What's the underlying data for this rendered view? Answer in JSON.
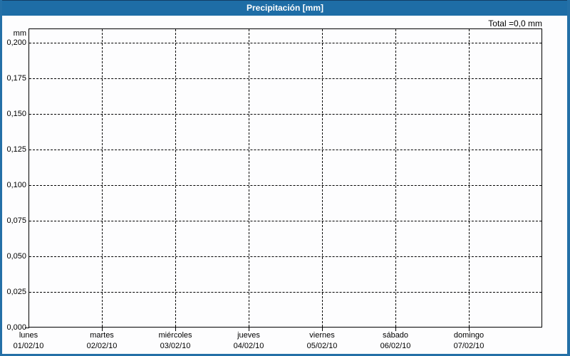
{
  "header": {
    "title": "Precipitación [mm]"
  },
  "summary": {
    "total_label": "Total =0,0 mm"
  },
  "y_axis": {
    "unit_label": "mm"
  },
  "chart_data": {
    "type": "bar",
    "title": "Precipitación [mm]",
    "xlabel": "",
    "ylabel": "mm",
    "ylim": [
      0,
      0.21
    ],
    "grid": "dashed-horizontal-and-vertical",
    "legend": "none",
    "total_annotation": "Total =0,0 mm",
    "y_ticks": [
      {
        "label": "0,200",
        "value": 0.2
      },
      {
        "label": "0,175",
        "value": 0.175
      },
      {
        "label": "0,150",
        "value": 0.15
      },
      {
        "label": "0,125",
        "value": 0.125
      },
      {
        "label": "0,100",
        "value": 0.1
      },
      {
        "label": "0,075",
        "value": 0.075
      },
      {
        "label": "0,050",
        "value": 0.05
      },
      {
        "label": "0,025",
        "value": 0.025
      },
      {
        "label": "0,000",
        "value": 0.0
      }
    ],
    "categories": [
      {
        "day": "lunes",
        "date": "01/02/10"
      },
      {
        "day": "martes",
        "date": "02/02/10"
      },
      {
        "day": "miércoles",
        "date": "03/02/10"
      },
      {
        "day": "jueves",
        "date": "04/02/10"
      },
      {
        "day": "viernes",
        "date": "05/02/10"
      },
      {
        "day": "sábado",
        "date": "06/02/10"
      },
      {
        "day": "domingo",
        "date": "07/02/10"
      }
    ],
    "values": [
      0,
      0,
      0,
      0,
      0,
      0,
      0
    ]
  },
  "colors": {
    "header_blue": "#1e6da6",
    "frame_blue": "#2470a7",
    "header_top_edge": "#123f66",
    "plot_border": "#000000",
    "gridline": "#000000",
    "background": "#fdfdfe",
    "title_text": "#ffffff",
    "label_text": "#000000"
  }
}
